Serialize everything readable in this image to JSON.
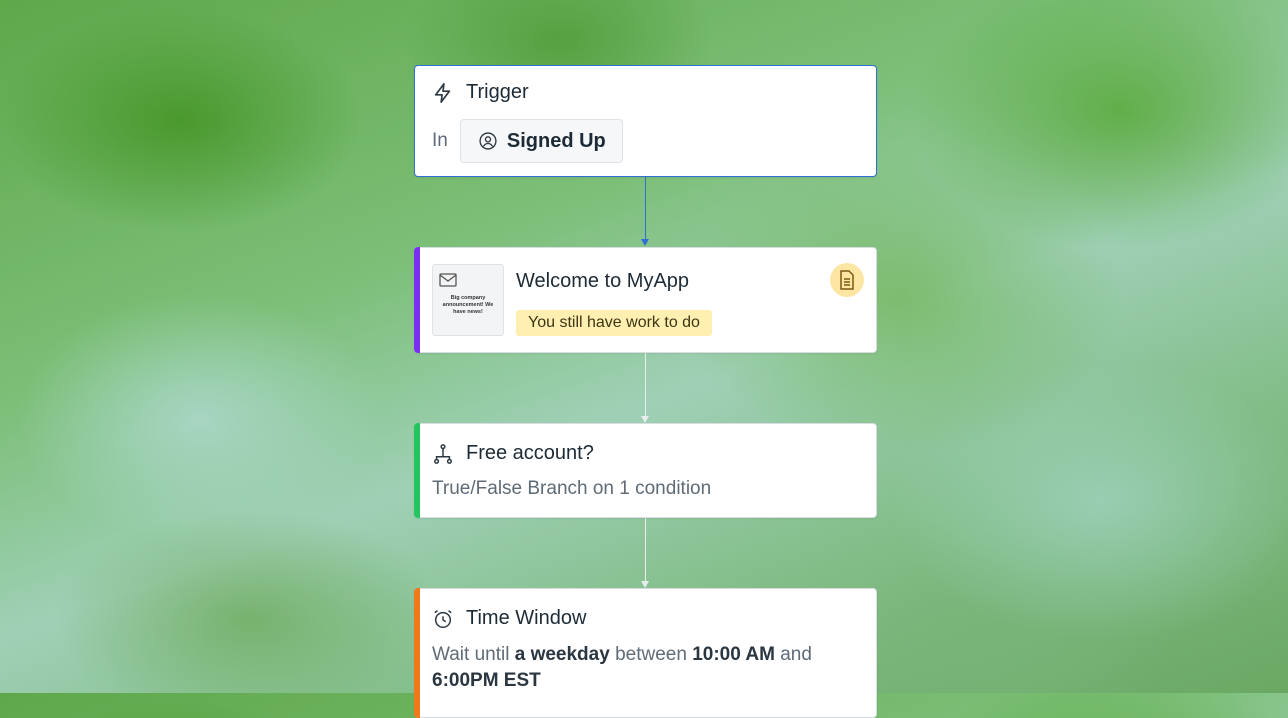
{
  "trigger": {
    "title": "Trigger",
    "in_label": "In",
    "event_label": "Signed Up",
    "icons": {
      "title": "lightning-icon",
      "event": "user-circle-icon"
    },
    "selected_border_color": "#2f6fd6"
  },
  "email": {
    "title": "Welcome to MyApp",
    "status": "You still have work to do",
    "thumbnail_text": "Big company announcement! We have news!",
    "accent_color": "#7b2ff0",
    "icons": {
      "thumbnail": "envelope-icon",
      "badge": "document-icon"
    }
  },
  "branch": {
    "title": "Free account?",
    "description": "True/False Branch on 1 condition",
    "accent_color": "#22c55e",
    "icons": {
      "title": "branch-icon"
    }
  },
  "time_window": {
    "title": "Time Window",
    "desc_prefix": "Wait until",
    "desc_day": "a weekday",
    "desc_between": "between",
    "desc_start": "10:00 AM",
    "desc_and": "and",
    "desc_end": "6:00PM EST",
    "accent_color": "#f07a1a",
    "icons": {
      "title": "alarm-clock-icon"
    }
  },
  "connectors": {
    "primary_color": "#2f6fd6",
    "secondary_color": "#e8ecef"
  }
}
